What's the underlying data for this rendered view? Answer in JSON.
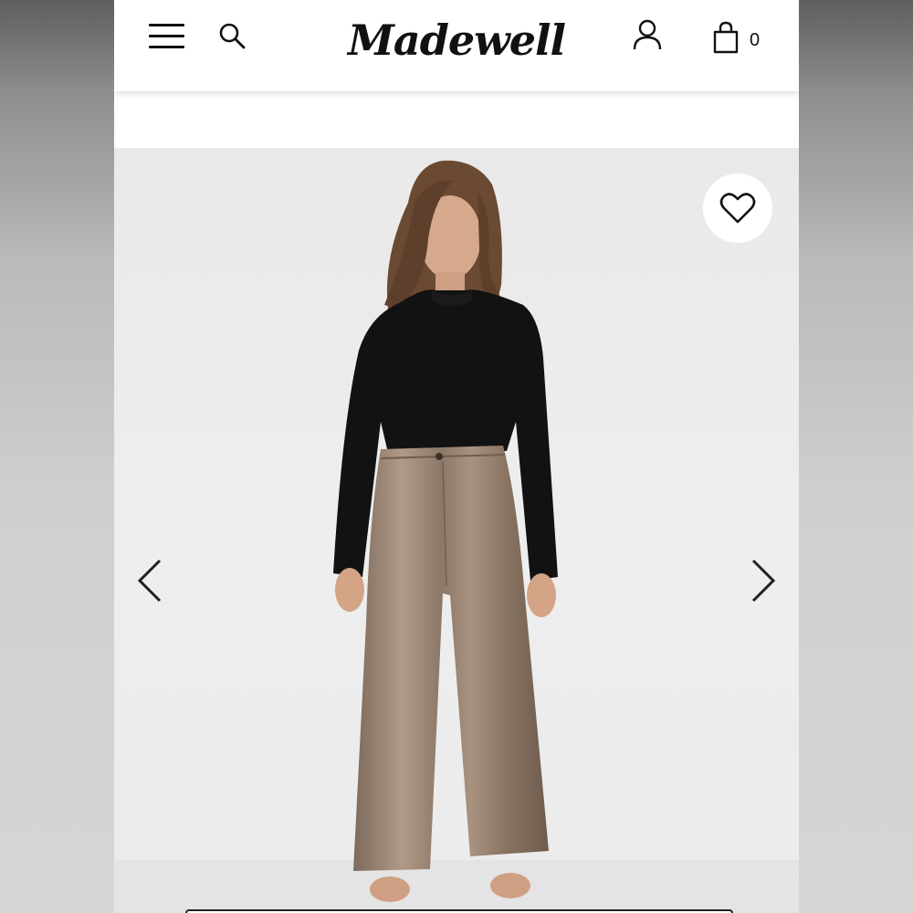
{
  "header": {
    "brand": "Madewell",
    "bag_count": "0",
    "icons": {
      "menu": "hamburger-menu-icon",
      "search": "search-icon",
      "account": "user-account-icon",
      "bag": "shopping-bag-icon"
    }
  },
  "product_image": {
    "favorite_icon": "heart-icon",
    "prev_icon": "chevron-left-icon",
    "next_icon": "chevron-right-icon"
  },
  "colors": {
    "top": "#111111",
    "pants": "#9a8474",
    "background": "#ececec"
  }
}
